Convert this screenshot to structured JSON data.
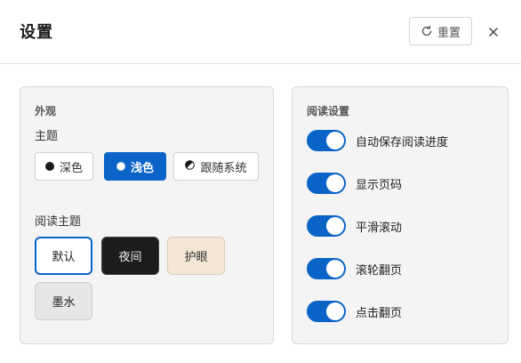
{
  "header": {
    "title": "设置",
    "reset_label": "重置"
  },
  "appearance": {
    "section_title": "外观",
    "theme_label": "主题",
    "themes": [
      {
        "label": "深色",
        "icon": "dark-dot-icon",
        "selected": false
      },
      {
        "label": "浅色",
        "icon": "light-dot-icon",
        "selected": true
      },
      {
        "label": "跟随系统",
        "icon": "half-circle-icon",
        "selected": false
      }
    ],
    "reading_theme_label": "阅读主题",
    "reading_themes": [
      {
        "label": "默认",
        "selected": true
      },
      {
        "label": "夜间",
        "selected": false
      },
      {
        "label": "护眼",
        "selected": false
      },
      {
        "label": "墨水",
        "selected": false
      }
    ]
  },
  "reading_settings": {
    "section_title": "阅读设置",
    "items": [
      {
        "label": "自动保存阅读进度",
        "enabled": true
      },
      {
        "label": "显示页码",
        "enabled": true
      },
      {
        "label": "平滑滚动",
        "enabled": true
      },
      {
        "label": "滚轮翻页",
        "enabled": true
      },
      {
        "label": "点击翻页",
        "enabled": true
      }
    ]
  },
  "colors": {
    "accent": "#0a64c8",
    "panel_bg": "#f4f4f4",
    "night_bg": "#1c1c1c",
    "eye_bg": "#f4e6d6",
    "ink_bg": "#e6e6e6"
  }
}
